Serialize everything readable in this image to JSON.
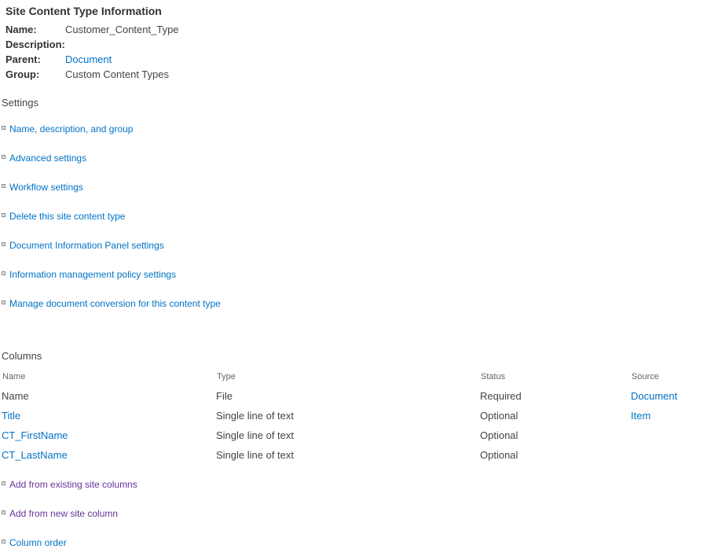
{
  "info": {
    "title": "Site Content Type Information",
    "fields": [
      {
        "label": "Name:",
        "value": "Customer_Content_Type",
        "is_link": false
      },
      {
        "label": "Description:",
        "value": "",
        "is_link": false
      },
      {
        "label": "Parent:",
        "value": "Document",
        "is_link": true
      },
      {
        "label": "Group:",
        "value": "Custom Content Types",
        "is_link": false
      }
    ]
  },
  "settings": {
    "heading": "Settings",
    "links": [
      "Name, description, and group",
      "Advanced settings",
      "Workflow settings",
      "Delete this site content type",
      "Document Information Panel settings",
      "Information management policy settings",
      "Manage document conversion for this content type"
    ]
  },
  "columns": {
    "heading": "Columns",
    "headers": [
      "Name",
      "Type",
      "Status",
      "Source"
    ],
    "rows": [
      {
        "name": "Name",
        "name_link": false,
        "type": "File",
        "status": "Required",
        "source": "Document"
      },
      {
        "name": "Title",
        "name_link": true,
        "type": "Single line of text",
        "status": "Optional",
        "source": "Item"
      },
      {
        "name": "CT_FirstName",
        "name_link": true,
        "type": "Single line of text",
        "status": "Optional",
        "source": ""
      },
      {
        "name": "CT_LastName",
        "name_link": true,
        "type": "Single line of text",
        "status": "Optional",
        "source": ""
      }
    ],
    "links": [
      "Add from existing site columns",
      "Add from new site column",
      "Column order"
    ]
  },
  "colors": {
    "link": "#0072c6",
    "visited_link": "#663399",
    "text": "#444444"
  }
}
